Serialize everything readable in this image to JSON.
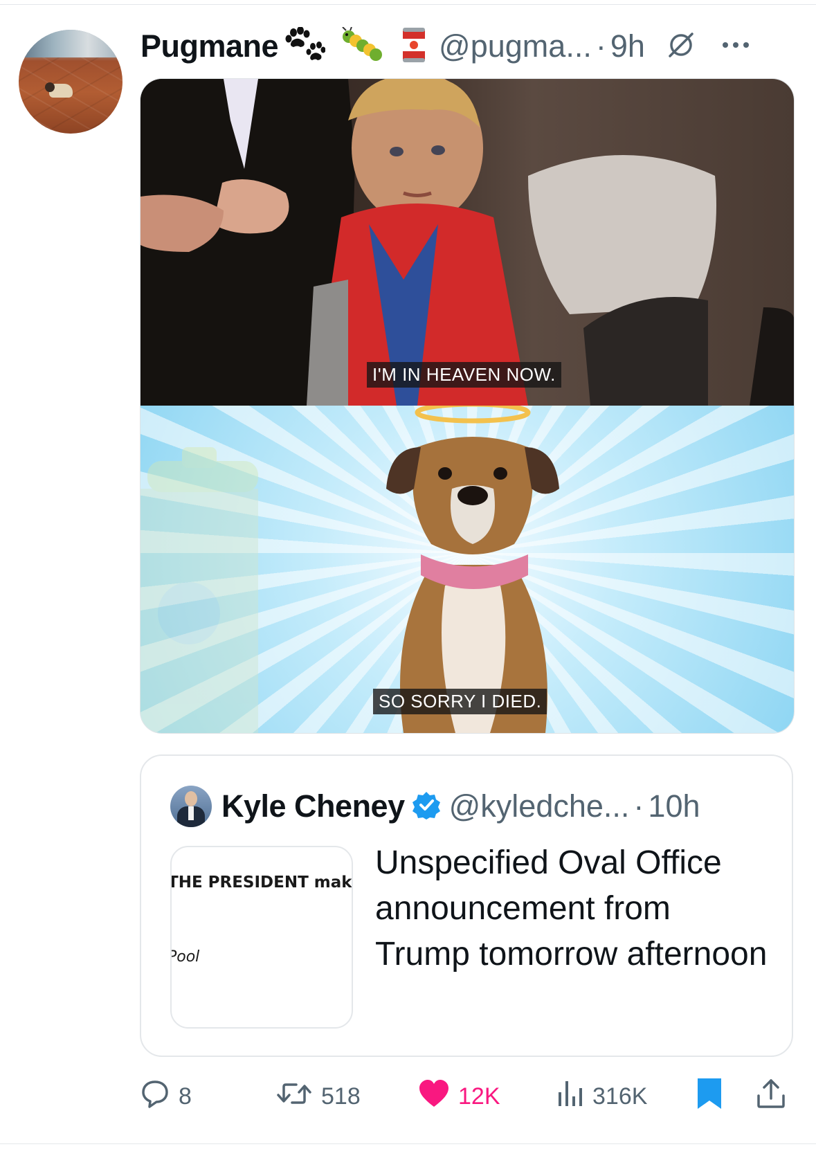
{
  "tweet": {
    "display_name": "Pugmane",
    "name_emojis": [
      "paw-prints-emoji",
      "bug-emoji",
      "tomato-can-emoji"
    ],
    "handle": "@pugma...",
    "separator": "·",
    "time": "9h",
    "avatar_icon": "pug-on-tile-floor-avatar"
  },
  "media": {
    "panel_top_caption": "I'M IN HEAVEN NOW.",
    "panel_bottom_caption": "SO SORRY I DIED."
  },
  "quote": {
    "display_name": "Kyle Cheney",
    "handle": "@kyledche...",
    "separator": "·",
    "time": "10h",
    "thumbnail_headline": "THE PRESIDENT makes",
    "thumbnail_credit": "Pool",
    "text": "Unspecified Oval Office announcement from Trump tomorrow afternoon"
  },
  "actions": {
    "replies": "8",
    "reposts": "518",
    "likes": "12K",
    "views": "316K"
  },
  "colors": {
    "secondary_text": "#536471",
    "like_pink": "#f91880",
    "accent_blue": "#1d9bf0",
    "primary_text": "#0f1419"
  }
}
